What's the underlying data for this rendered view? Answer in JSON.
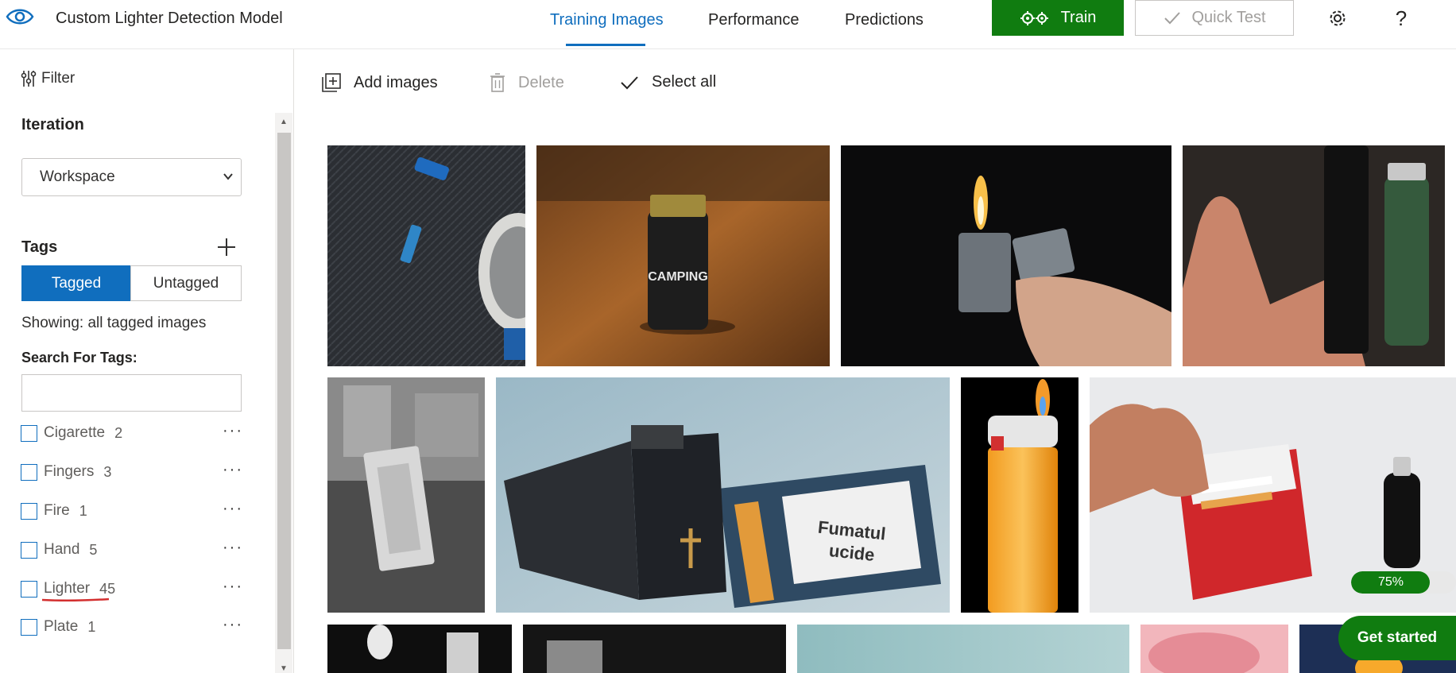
{
  "header": {
    "app_title": "Custom Lighter Detection Model",
    "tabs": [
      {
        "label": "Training Images",
        "active": true
      },
      {
        "label": "Performance",
        "active": false
      },
      {
        "label": "Predictions",
        "active": false
      }
    ],
    "train_label": "Train",
    "quick_test_label": "Quick Test",
    "help_label": "?"
  },
  "sidebar": {
    "filter_label": "Filter",
    "iteration_title": "Iteration",
    "iteration_value": "Workspace",
    "tags_title": "Tags",
    "tagged_label": "Tagged",
    "untagged_label": "Untagged",
    "showing_text": "Showing: all tagged images",
    "search_label": "Search For Tags:",
    "search_value": "",
    "tags": [
      {
        "name": "Cigarette",
        "count": "2"
      },
      {
        "name": "Fingers",
        "count": "3"
      },
      {
        "name": "Fire",
        "count": "1"
      },
      {
        "name": "Hand",
        "count": "5"
      },
      {
        "name": "Lighter",
        "count": "45"
      },
      {
        "name": "Plate",
        "count": "1"
      }
    ],
    "more_label": "···"
  },
  "toolbar": {
    "add_images": "Add images",
    "delete": "Delete",
    "select_all": "Select all"
  },
  "images": {
    "fumatul_line1": "Fumatul",
    "fumatul_line2": "ucide",
    "camping_text": "CAMPING"
  },
  "progress": {
    "value": 0.75,
    "label": "75%"
  },
  "get_started_label": "Get started",
  "colors": {
    "accent": "#106ebe",
    "train_green": "#107c10"
  }
}
